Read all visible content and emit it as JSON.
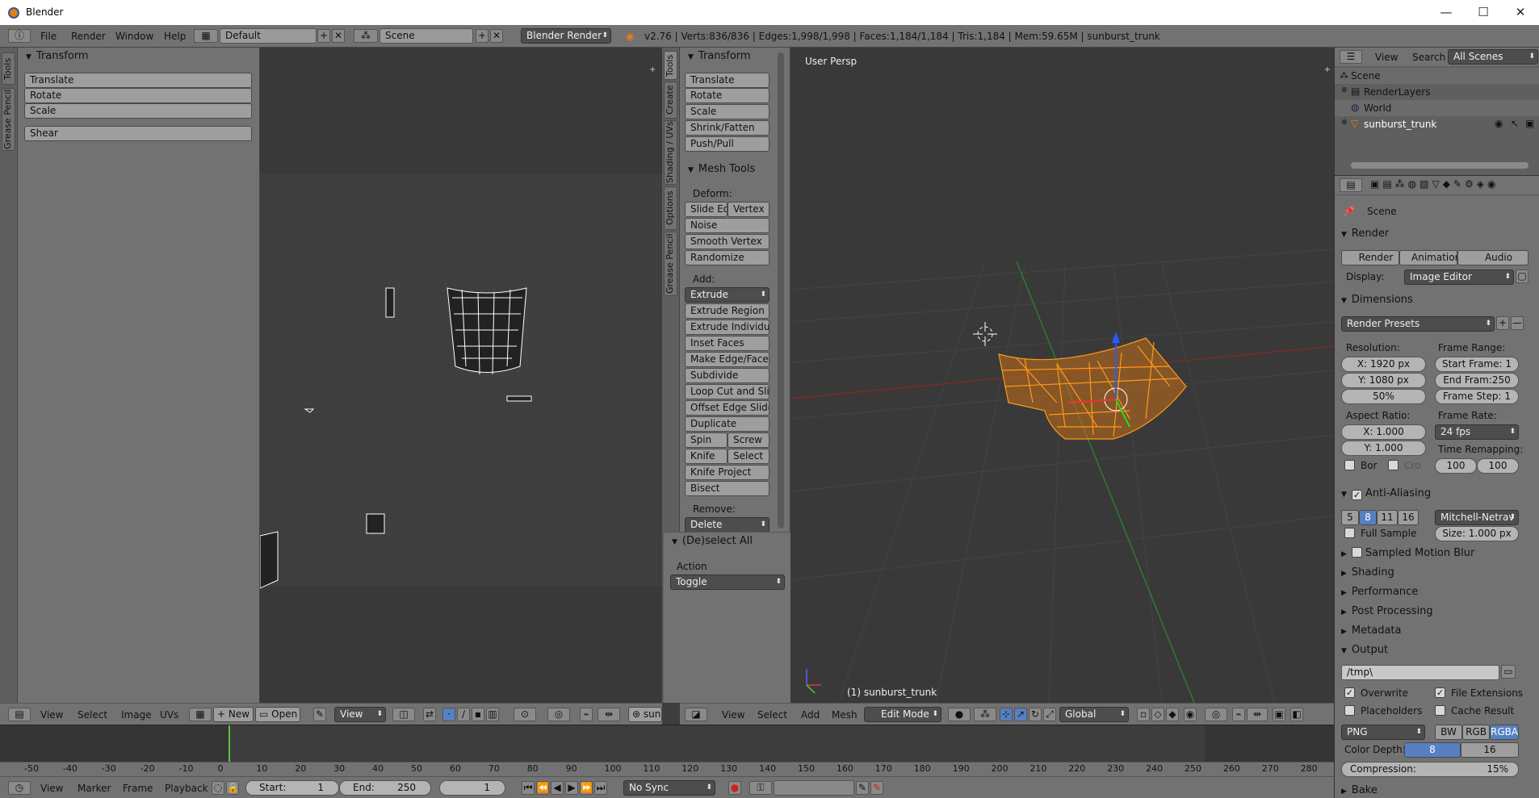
{
  "window": {
    "title": "Blender",
    "minimize": "—",
    "maximize": "☐",
    "close": "✕"
  },
  "info": {
    "menus": [
      "File",
      "Render",
      "Window",
      "Help"
    ],
    "layout": "Default",
    "scene": "Scene",
    "engine": "Blender Render",
    "stats": "v2.76 | Verts:836/836 | Edges:1,998/1,998 | Faces:1,184/1,184 | Tris:1,184 | Mem:59.65M | sunburst_trunk"
  },
  "image_editor": {
    "tabs": [
      "Tools",
      "Grease Pencil"
    ],
    "transform": {
      "title": "Transform",
      "buttons": [
        "Translate",
        "Rotate",
        "Scale",
        "Shear"
      ]
    },
    "header": {
      "menus": [
        "View",
        "Select",
        "Image",
        "UVs"
      ],
      "new": "New",
      "open": "Open",
      "view": "View",
      "obj": "sunb"
    }
  },
  "toolshelf": {
    "tabs": [
      "Tools",
      "Create",
      "Shading / UVs",
      "Options",
      "Grease Pencil"
    ],
    "transform": {
      "title": "Transform",
      "buttons": [
        "Translate",
        "Rotate",
        "Scale",
        "Shrink/Fatten",
        "Push/Pull"
      ]
    },
    "mesh_tools": {
      "title": "Mesh Tools",
      "deform_label": "Deform:",
      "slide_edge": "Slide Ed",
      "vertex": "Vertex",
      "noise": "Noise",
      "smooth_vertex": "Smooth Vertex",
      "randomize": "Randomize",
      "add_label": "Add:",
      "extrude": "Extrude",
      "add_buttons": [
        "Extrude Region",
        "Extrude Individual",
        "Inset Faces",
        "Make Edge/Face",
        "Subdivide",
        "Loop Cut and Slide",
        "Offset Edge Slide",
        "Duplicate"
      ],
      "spin": "Spin",
      "screw": "Screw",
      "knife": "Knife",
      "select": "Select",
      "knife_project": "Knife Project",
      "bisect": "Bisect",
      "remove_label": "Remove:",
      "delete": "Delete"
    },
    "operator": {
      "title": "(De)select All",
      "action_label": "Action",
      "action_value": "Toggle"
    }
  },
  "viewport": {
    "label": "User Persp",
    "object_label": "(1) sunburst_trunk",
    "header": {
      "menus": [
        "View",
        "Select",
        "Add",
        "Mesh"
      ],
      "mode": "Edit Mode",
      "orientation": "Global"
    }
  },
  "outliner": {
    "menus": [
      "View",
      "Search"
    ],
    "filter": "All Scenes",
    "items": [
      "Scene",
      "RenderLayers",
      "World",
      "sunburst_trunk"
    ]
  },
  "properties": {
    "context": "Scene",
    "render": {
      "title": "Render",
      "render_btn": "Render",
      "animation_btn": "Animation",
      "audio_btn": "Audio",
      "display_label": "Display:",
      "display_value": "Image Editor"
    },
    "dimensions": {
      "title": "Dimensions",
      "presets": "Render Presets",
      "resolution_label": "Resolution:",
      "res_x": "X:",
      "res_x_val": "1920 px",
      "res_y": "Y:",
      "res_y_val": "1080 px",
      "res_pct": "50%",
      "frame_range_label": "Frame Range:",
      "start": "Start Frame: 1",
      "end": "End Fram:250",
      "step": "Frame Step: 1",
      "aspect_label": "Aspect Ratio:",
      "asp_x": "X:",
      "asp_x_val": "1.000",
      "asp_y": "Y:",
      "asp_y_val": "1.000",
      "frame_rate_label": "Frame Rate:",
      "fps": "24 fps",
      "time_remap_label": "Time Remapping:",
      "border": "Bor",
      "crop": "Cro",
      "remap_old": "100",
      "remap_new": "100"
    },
    "anti_aliasing": {
      "title": "Anti-Aliasing",
      "samples": [
        "5",
        "8",
        "11",
        "16"
      ],
      "filter": "Mitchell-Netrav",
      "full_sample": "Full Sample",
      "size": "Size: 1.000 px"
    },
    "collapsed": [
      "Sampled Motion Blur",
      "Shading",
      "Performance",
      "Post Processing",
      "Metadata"
    ],
    "output": {
      "title": "Output",
      "path": "/tmp\\",
      "overwrite": "Overwrite",
      "file_ext": "File Extensions",
      "placeholders": "Placeholders",
      "cache": "Cache Result",
      "format": "PNG",
      "bw": "BW",
      "rgb": "RGB",
      "rgba": "RGBA",
      "color_depth_label": "Color Depth:",
      "depth8": "8",
      "depth16": "16",
      "compression": "Compression:",
      "compression_val": "15%"
    },
    "bake": "Bake"
  },
  "timeline": {
    "ticks": [
      "-50",
      "-40",
      "-30",
      "-20",
      "-10",
      "0",
      "10",
      "20",
      "30",
      "40",
      "50",
      "60",
      "70",
      "80",
      "90",
      "100",
      "110",
      "120",
      "130",
      "140",
      "150",
      "160",
      "170",
      "180",
      "190",
      "200",
      "210",
      "220",
      "230",
      "240",
      "250",
      "260",
      "270",
      "280"
    ],
    "menus": [
      "View",
      "Marker",
      "Frame",
      "Playback"
    ],
    "start": "Start:",
    "start_val": "1",
    "end": "End:",
    "end_val": "250",
    "current": "1",
    "sync": "No Sync"
  }
}
